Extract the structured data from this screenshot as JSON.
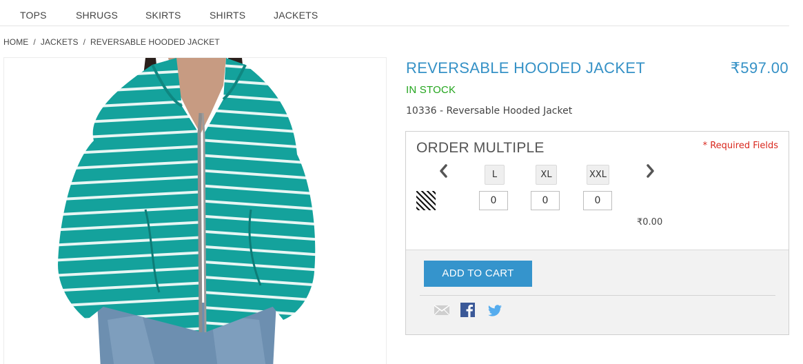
{
  "nav": {
    "items": [
      {
        "label": "TOPS"
      },
      {
        "label": "SHRUGS"
      },
      {
        "label": "SKIRTS"
      },
      {
        "label": "SHIRTS"
      },
      {
        "label": "JACKETS"
      }
    ]
  },
  "breadcrumb": {
    "items": [
      "HOME",
      "JACKETS",
      "REVERSABLE HOODED JACKET"
    ],
    "separator": "/"
  },
  "product": {
    "title": "REVERSABLE HOODED JACKET",
    "price": "₹597.00",
    "stock": "IN STOCK",
    "sku_line": "10336 - Reversable Hooded Jacket",
    "image_colors": {
      "jacket": "#14a29c",
      "stripe": "#e8f6f4",
      "zipper": "#8d8d8d",
      "skin": "#c79b82",
      "hair": "#2a1f1b",
      "jeans": "#6d8fb0"
    }
  },
  "order": {
    "title": "ORDER MULTIPLE",
    "required_label": "* Required Fields",
    "prev_icon": "chevron-left-icon",
    "next_icon": "chevron-right-icon",
    "sizes": [
      "L",
      "XL",
      "XXL"
    ],
    "quantities": [
      "0",
      "0",
      "0"
    ],
    "swatch_icon": "diagonal-stripe-swatch-icon",
    "total": "₹0.00",
    "add_to_cart_label": "ADD TO CART"
  },
  "share": {
    "icons": [
      "email-icon",
      "facebook-icon",
      "twitter-icon"
    ]
  },
  "colors": {
    "accent": "#3591c6",
    "in_stock": "#22a51c",
    "required": "#d9271d",
    "button": "#3594cc"
  }
}
